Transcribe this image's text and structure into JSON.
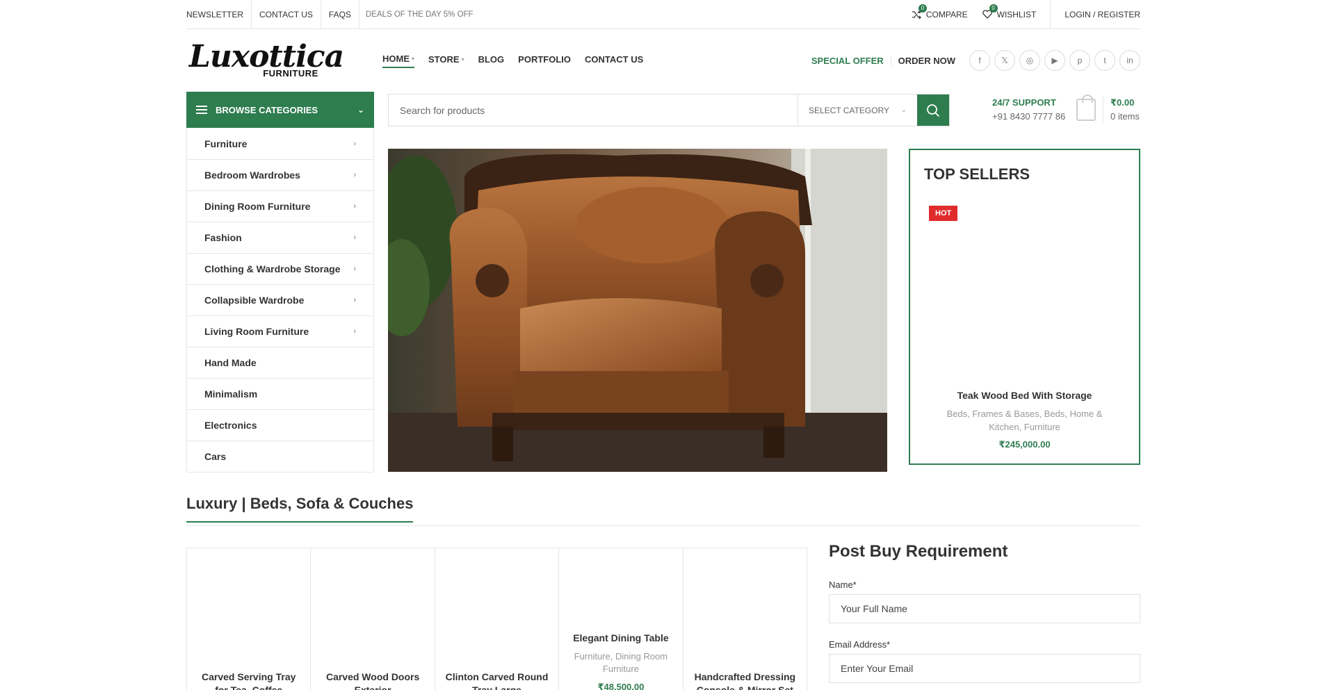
{
  "topbar": {
    "links": [
      "NEWSLETTER",
      "CONTACT US",
      "FAQS"
    ],
    "deal": "DEALS OF THE DAY 5% OFF",
    "compare_label": "COMPARE",
    "compare_count": "0",
    "wishlist_label": "WISHLIST",
    "wishlist_count": "0",
    "login_label": "LOGIN / REGISTER"
  },
  "logo": {
    "script": "Luxottica",
    "sub": "FURNITURE"
  },
  "nav": {
    "items": [
      "HOME",
      "STORE",
      "BLOG",
      "PORTFOLIO",
      "CONTACT US"
    ]
  },
  "header_right": {
    "special_offer": "SPECIAL OFFER",
    "order_now": "ORDER NOW",
    "social_icons": [
      "facebook-icon",
      "x-icon",
      "instagram-icon",
      "youtube-icon",
      "pinterest-icon",
      "tumblr-icon",
      "linkedin-icon"
    ]
  },
  "browse": {
    "label": "BROWSE CATEGORIES"
  },
  "search": {
    "placeholder": "Search for products",
    "category_label": "SELECT CATEGORY"
  },
  "support": {
    "title": "24/7 SUPPORT",
    "phone": "+91 8430 7777 86"
  },
  "cart": {
    "price": "₹0.00",
    "items": "0 items"
  },
  "categories": [
    "Furniture",
    "Bedroom Wardrobes",
    "Dining Room Furniture",
    "Fashion",
    "Clothing & Wardrobe Storage",
    "Collapsible Wardrobe",
    "Living Room Furniture",
    "Hand Made",
    "Minimalism",
    "Electronics",
    "Cars"
  ],
  "top_sellers": {
    "title": "TOP SELLERS",
    "badge": "HOT",
    "product_name": "Teak Wood Bed With Storage",
    "product_categories": "Beds, Frames & Bases, Beds, Home & Kitchen, Furniture",
    "product_price": "₹245,000.00"
  },
  "section": {
    "title": "Luxury | Beds, Sofa & Couches"
  },
  "products": [
    {
      "name": "Carved Serving Tray for Tea, Coffee"
    },
    {
      "name": "Carved Wood Doors Exterior"
    },
    {
      "name": "Clinton Carved Round Tray Large"
    },
    {
      "name": "Elegant Dining Table",
      "categories": "Furniture, Dining Room Furniture",
      "price": "₹48,500.00"
    },
    {
      "name": "Handcrafted Dressing Console & Mirror Set"
    }
  ],
  "form": {
    "title": "Post Buy Requirement",
    "name_label": "Name*",
    "name_placeholder": "Your Full Name",
    "email_label": "Email Address*",
    "email_placeholder": "Enter Your Email"
  }
}
